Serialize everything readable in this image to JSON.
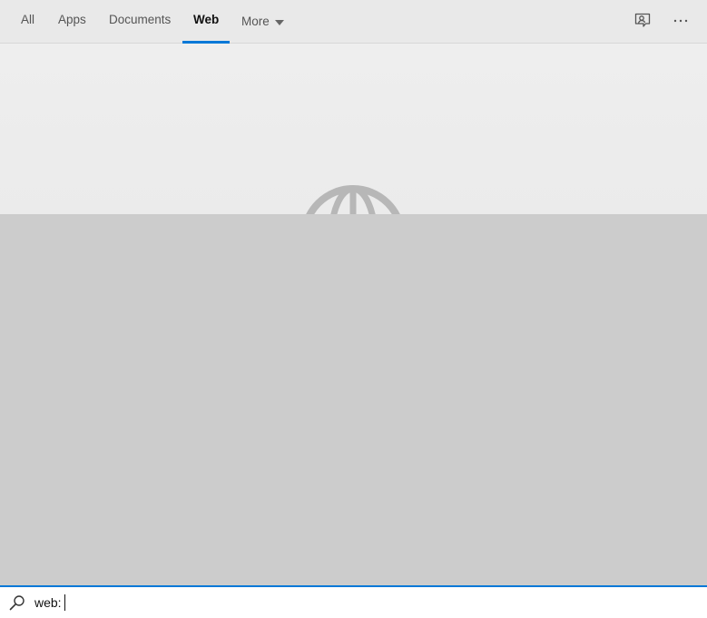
{
  "tabs": {
    "all": "All",
    "apps": "Apps",
    "documents": "Documents",
    "web": "Web",
    "more": "More"
  },
  "icons": {
    "feedback": "feedback-icon",
    "more_options": "ellipsis-icon",
    "hero": "globe-icon",
    "search": "search-icon"
  },
  "search": {
    "value": "web:"
  },
  "colors": {
    "accent": "#0078d7"
  }
}
